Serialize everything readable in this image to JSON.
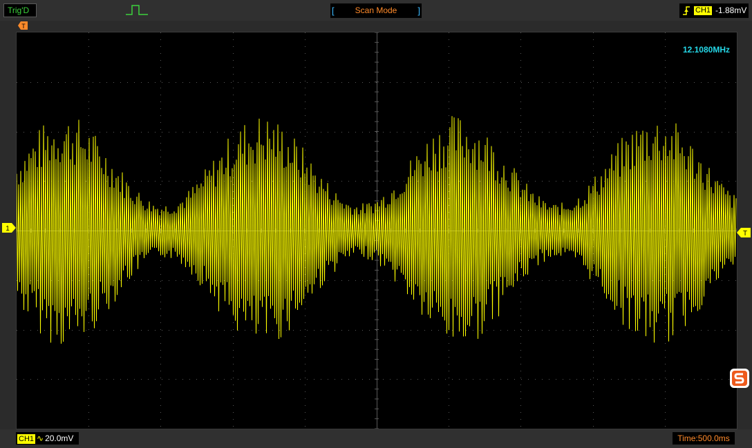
{
  "status": {
    "trigger_state": "Trig'D",
    "mode": "Scan Mode",
    "mode_bracket_left": "[",
    "mode_bracket_right": "]"
  },
  "trigger": {
    "channel": "CH1",
    "level": "-1.88mV",
    "edge_icon": "rising-edge-icon"
  },
  "markers": {
    "time_marker": "T",
    "channel_marker": "1",
    "trigger_marker": "T"
  },
  "measurement": {
    "frequency": "12.1080MHz"
  },
  "channel_scale": {
    "channel": "CH1",
    "coupling_symbol": "∿",
    "volts_per_div": "20.0mV"
  },
  "timebase": {
    "label": "Time:500.0ms"
  },
  "colors": {
    "trace": "#ffff00",
    "background": "#000000",
    "grid": "#5a5a5a",
    "frequency": "#25d8e8",
    "mode_text": "#ff8a2a"
  }
}
